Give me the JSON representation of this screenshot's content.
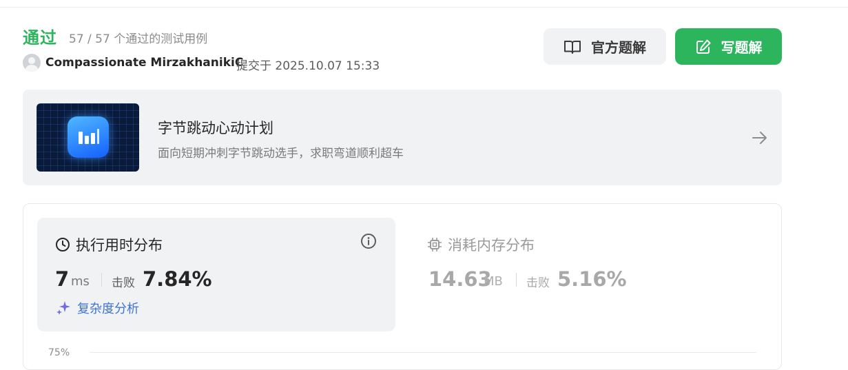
{
  "result": {
    "status": "通过",
    "count": "57 / 57 个通过的测试用例"
  },
  "submission": {
    "username": "Compassionate MirzakhanikiC",
    "submitted_text": "提交于 2025.10.07 15:33"
  },
  "actions": {
    "official_solution": "官方题解",
    "write_solution": "写题解"
  },
  "banner": {
    "title": "字节跳动心动计划",
    "subtitle": "面向短期冲刺字节跳动选手，求职弯道顺利超车"
  },
  "runtime": {
    "title": "执行用时分布",
    "value": "7",
    "unit": "ms",
    "beat_label": "击败",
    "beat_percent": "7.84%",
    "complexity_link": "复杂度分析"
  },
  "memory": {
    "title": "消耗内存分布",
    "value": "14.63",
    "unit": "MB",
    "beat_label": "击败",
    "beat_percent": "5.16%"
  },
  "chart": {
    "axis_label": "75%"
  },
  "colors": {
    "accent_green": "#2db55d",
    "link_blue": "#3e73d6",
    "panel_bg": "#f1f2f4"
  },
  "icons": {
    "official_solution": "book-icon",
    "write_solution": "edit-icon",
    "runtime": "clock-icon",
    "memory": "chip-icon",
    "info": "info-icon",
    "complexity": "sparkle-icon",
    "banner_arrow": "arrow-right-icon"
  }
}
